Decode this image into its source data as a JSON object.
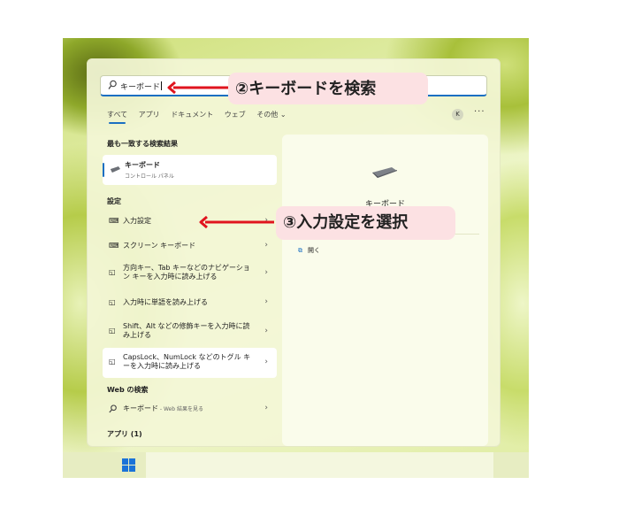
{
  "search": {
    "value": "キーボード"
  },
  "filter_tabs": [
    {
      "label": "すべて",
      "active": true
    },
    {
      "label": "アプリ",
      "active": false
    },
    {
      "label": "ドキュメント",
      "active": false
    },
    {
      "label": "ウェブ",
      "active": false
    },
    {
      "label": "その他 ⌄",
      "active": false
    }
  ],
  "user_avatar": "K",
  "more_label": "···",
  "sections": {
    "best_match": "最も一致する検索結果",
    "settings": "設定",
    "web": "Web の検索",
    "apps": "アプリ (1)"
  },
  "best_match": {
    "title": "キーボード",
    "subtitle": "コントロール パネル"
  },
  "settings_items": [
    {
      "label": "入力設定",
      "icon": "keyboard-icon"
    },
    {
      "label": "スクリーン キーボード",
      "icon": "keyboard-icon"
    },
    {
      "label": "方向キー、Tab キーなどのナビゲーション キーを入力時に読み上げる",
      "icon": "narrator-icon"
    },
    {
      "label": "入力時に単語を読み上げる",
      "icon": "narrator-icon"
    },
    {
      "label": "Shift、Alt などの修飾キーを入力時に読み上げる",
      "icon": "narrator-icon"
    },
    {
      "label": "CapsLock、NumLock などのトグル キーを入力時に読み上げる",
      "icon": "narrator-icon"
    }
  ],
  "web_item": {
    "label": "キーボード",
    "suffix": " - Web 結果を見る"
  },
  "preview": {
    "title": "キーボード",
    "action_label": "開く"
  },
  "annotations": {
    "search_callout": "②キーボードを検索",
    "select_callout": "③入力設定を選択"
  },
  "colors": {
    "accent": "#1b6fc2",
    "arrow": "#e0141e",
    "callout_bg": "#fce1e3"
  }
}
